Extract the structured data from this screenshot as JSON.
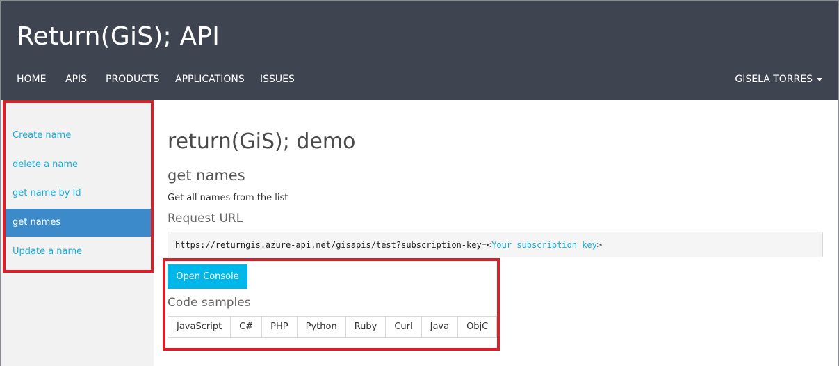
{
  "header": {
    "brand": "Return(GiS); API",
    "nav": [
      {
        "label": "HOME"
      },
      {
        "label": "APIS"
      },
      {
        "label": "PRODUCTS"
      },
      {
        "label": "APPLICATIONS"
      },
      {
        "label": "ISSUES"
      }
    ],
    "user": "GISELA TORRES"
  },
  "sidebar": {
    "items": [
      {
        "label": "Create name",
        "active": false
      },
      {
        "label": "delete a name",
        "active": false
      },
      {
        "label": "get name by Id",
        "active": false
      },
      {
        "label": "get names",
        "active": true
      },
      {
        "label": "Update a name",
        "active": false
      }
    ]
  },
  "main": {
    "title": "return(GiS); demo",
    "operation": "get names",
    "description": "Get all names from the list",
    "request_url_label": "Request URL",
    "request_url": "https://returngis.azure-api.net/gisapis/test?subscription-key=<",
    "request_url_key": "Your subscription key",
    "request_url_end": ">",
    "console_button": "Open Console",
    "code_samples_label": "Code samples",
    "code_tabs": [
      "JavaScript",
      "C#",
      "PHP",
      "Python",
      "Ruby",
      "Curl",
      "Java",
      "ObjC"
    ]
  },
  "colors": {
    "header_bg": "#3f4550",
    "link": "#14aee0",
    "active_item": "#3c8ac9",
    "button": "#00b7ea",
    "highlight_border": "#d6202a"
  }
}
